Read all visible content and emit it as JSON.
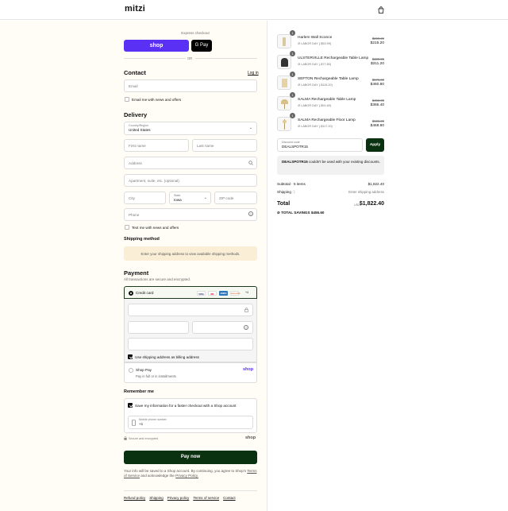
{
  "store": {
    "name": "mitzi"
  },
  "express": {
    "label": "Express checkout",
    "shop_btn": "shop",
    "gpay_btn": "G Pay",
    "or": "OR"
  },
  "contact": {
    "heading": "Contact",
    "login": "Log in",
    "email_ph": "Email",
    "news_label": "Email me with news and offers"
  },
  "delivery": {
    "heading": "Delivery",
    "country_label": "Country/Region",
    "country_value": "United States",
    "first_ph": "First name",
    "last_ph": "Last name",
    "address_ph": "Address",
    "apt_ph": "Apartment, suite, etc. (optional)",
    "city_ph": "City",
    "state_label": "State",
    "state_value": "Iowa",
    "zip_ph": "ZIP code",
    "phone_ph": "Phone",
    "text_label": "Text me with news and offers"
  },
  "shipping": {
    "heading": "Shipping method",
    "info": "Enter your shipping address to view available shipping methods."
  },
  "payment": {
    "heading": "Payment",
    "sub": "All transactions are secure and encrypted.",
    "credit_label": "Credit card",
    "cards": [
      "VISA",
      "MC",
      "AMEX",
      "DISCOVER",
      "+4"
    ],
    "billing_label": "Use shipping address as billing address",
    "shoppay_label": "Shop Pay",
    "shoppay_sub": "Pay in full or in installments",
    "shoppay_logo": "shop"
  },
  "remember": {
    "heading": "Remember me",
    "save_label": "Save my information for a faster checkout with a Shop account",
    "mobile_label": "Mobile phone number",
    "mobile_value": "+1",
    "secure": "Secure and encrypted",
    "shop_logo": "shop"
  },
  "pay": {
    "button": "Pay now",
    "terms_a": "Your info will be saved to a Shop account. By continuing, you agree to Shop's",
    "terms_link": "Terms of Service",
    "terms_b": "and acknowledge the",
    "privacy_link": "Privacy Policy."
  },
  "footer": {
    "links": [
      "Refund policy",
      "Shipping",
      "Privacy policy",
      "Terms of service",
      "Contact"
    ]
  },
  "cart": {
    "items": [
      {
        "qty": "1",
        "name": "Harlem Wall Sconce",
        "discount": "LABOR DAY (-$53.99)",
        "old": "$269.29",
        "new": "$215.20"
      },
      {
        "qty": "1",
        "name": "ULSTERVILLE Rechargeable Table Lamp",
        "discount": "LABOR DAY (-$77.80)",
        "old": "$389.00",
        "new": "$311.20"
      },
      {
        "qty": "1",
        "name": "SEFTON Rechargeable Table Lamp",
        "discount": "LABOR DAY (-$115.20)",
        "old": "$576.00",
        "new": "$460.80"
      },
      {
        "qty": "1",
        "name": "SALMA Rechargeable Table Lamp",
        "discount": "LABOR DAY (-$91.60)",
        "old": "$458.00",
        "new": "$366.40"
      },
      {
        "qty": "1",
        "name": "SALMA Rechargeable Floor Lamp",
        "discount": "LABOR DAY (-$117.20)",
        "old": "$586.00",
        "new": "$468.80"
      }
    ],
    "discount_label": "Discount code",
    "discount_value": "DEALSPOTR15",
    "apply": "Apply",
    "error_bold": "DEALSPOTR15",
    "error_rest": " couldn't be used with your existing discounts.",
    "subtotal_label": "Subtotal · 5 items",
    "subtotal_value": "$1,822.40",
    "shipping_label": "Shipping",
    "shipping_value": "Enter shipping address",
    "total_label": "Total",
    "currency": "USD",
    "total_value": "$1,822.40",
    "savings_label": "TOTAL SAVINGS",
    "savings_value": "$455.60"
  }
}
